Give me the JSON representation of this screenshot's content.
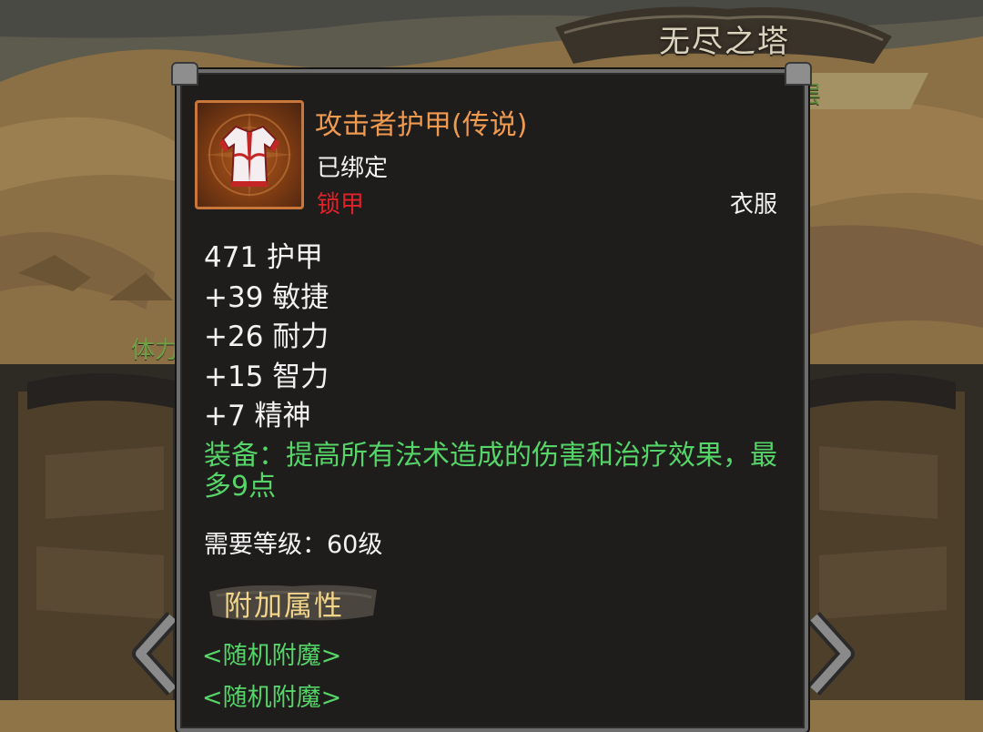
{
  "background": {
    "title": "无尽之塔",
    "floor_label_fragment": "层",
    "stamina_label_fragment": "体力"
  },
  "item": {
    "name": "攻击者护甲(传说)",
    "bind_status": "已绑定",
    "armor_type": "锁甲",
    "slot": "衣服",
    "icon": "robe-icon",
    "stats": [
      "471 护甲",
      "+39 敏捷",
      "+26 耐力",
      "+15 智力",
      "+7 精神"
    ],
    "equip_effect": "装备：提高所有法术造成的伤害和治疗效果，最多9点",
    "required_level": "需要等级：60级",
    "extra_attributes_header": "附加属性",
    "random_enchantments": [
      "<随机附魔>",
      "<随机附魔>"
    ]
  },
  "colors": {
    "item_name": "#f09a50",
    "armor_type": "#e0222a",
    "equip_effect": "#55d468",
    "panel_bg": "#1f1d1c",
    "icon_border": "#c9763a"
  }
}
